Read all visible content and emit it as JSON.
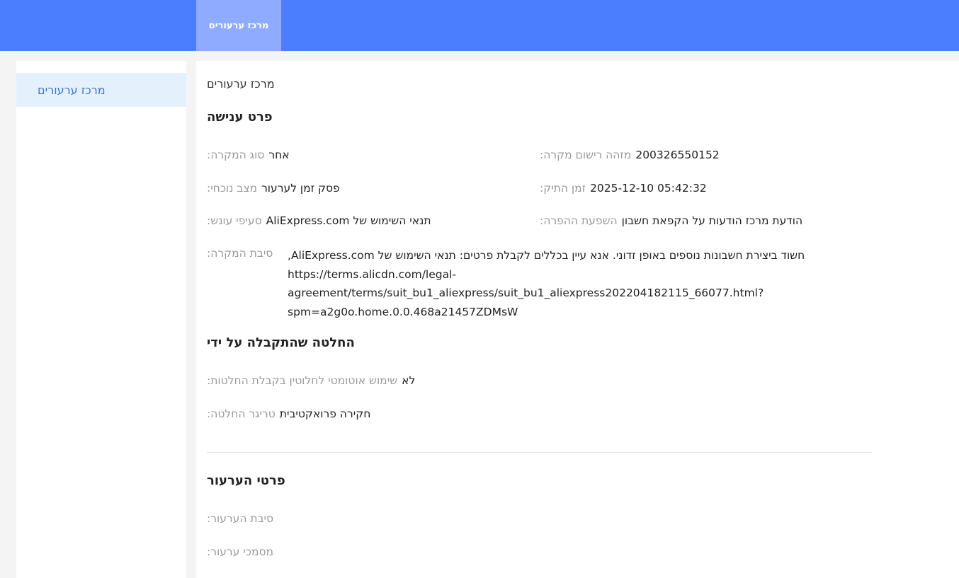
{
  "header": {
    "tab_label": "מרכז ערעורים"
  },
  "sidebar": {
    "items": [
      {
        "label": "מרכז ערעורים"
      }
    ]
  },
  "main": {
    "breadcrumb": "מרכז ערעורים",
    "penalty_section": {
      "title": "פרט ענישה",
      "case_type_label": "סוג המקרה:",
      "case_type_value": "אחר",
      "case_id_label": "מזהה רישום מקרה:",
      "case_id_value": "200326550152",
      "status_label": "מצב נוכחי:",
      "status_value": "פסק זמן לערעור",
      "file_time_label": "זמן התיק:",
      "file_time_value": "2025-12-10 05:42:32",
      "clauses_label": "סעיפי עונש:",
      "clauses_value": "תנאי השימוש של AliExpress.com",
      "impact_label": "השפעת ההפרה:",
      "impact_value": "הודעת מרכז הודעות על הקפאת חשבון",
      "reason_label": "סיבת המקרה:",
      "reason_text": "חשוד ביצירת חשבונות נוספים באופן זדוני. אנא עיין בכללים לקבלת פרטים: תנאי השימוש של AliExpress.com,",
      "reason_url_lines": [
        "https://terms.alicdn.com/legal-",
        "agreement/terms/suit_bu1_aliexpress/suit_bu1_aliexpress202204182115_66077.html?",
        "spm=a2g0o.home.0.0.468a21457ZDMsW"
      ]
    },
    "decision_section": {
      "title": "החלטה שהתקבלה על ידי",
      "automation_label": "שימוש אוטומטי לחלוטין בקבלת החלטות:",
      "automation_value": "לא",
      "trigger_label": "טריגר החלטה:",
      "trigger_value": "חקירה פרואקטיבית"
    },
    "appeal_section": {
      "title": "פרטי הערעור",
      "reason_label": "סיבת הערעור:",
      "documents_label": "מסמכי ערעור:"
    }
  }
}
